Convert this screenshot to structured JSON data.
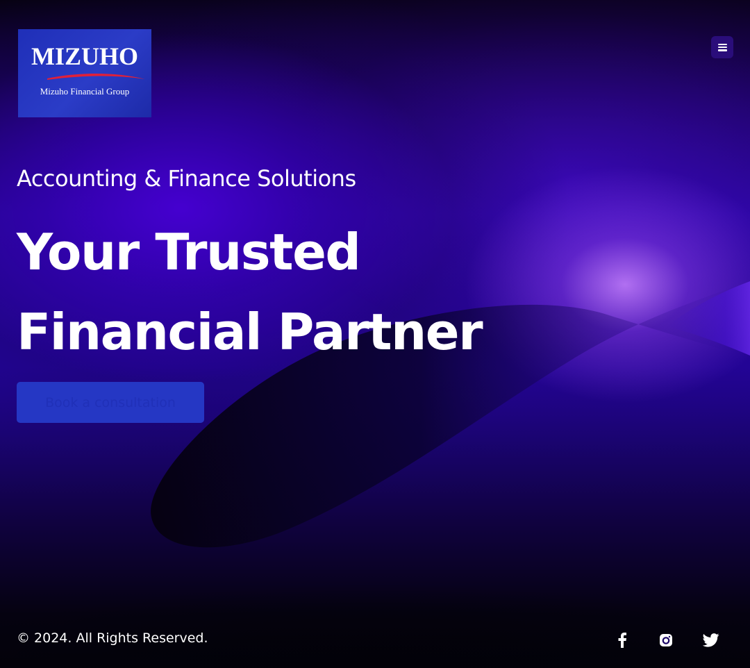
{
  "brand": {
    "logo_wordmark": "MIZUHO",
    "logo_subtitle": "Mizuho Financial Group",
    "logo_bg": "#2535c0",
    "swoosh_color": "#e0203a"
  },
  "header": {
    "menu_icon": "hamburger-menu-icon"
  },
  "hero": {
    "subtitle": "Accounting & Finance Solutions",
    "headline_line1": "Your Trusted",
    "headline_line2": "Financial Partner",
    "cta_label": "Book a consultation"
  },
  "footer": {
    "copyright": "© 2024. All Rights Reserved.",
    "social": [
      {
        "icon": "facebook-icon"
      },
      {
        "icon": "instagram-icon"
      },
      {
        "icon": "twitter-icon"
      }
    ]
  },
  "colors": {
    "accent": "#2537c4",
    "text": "#ffffff",
    "glow": "#c98cff"
  }
}
